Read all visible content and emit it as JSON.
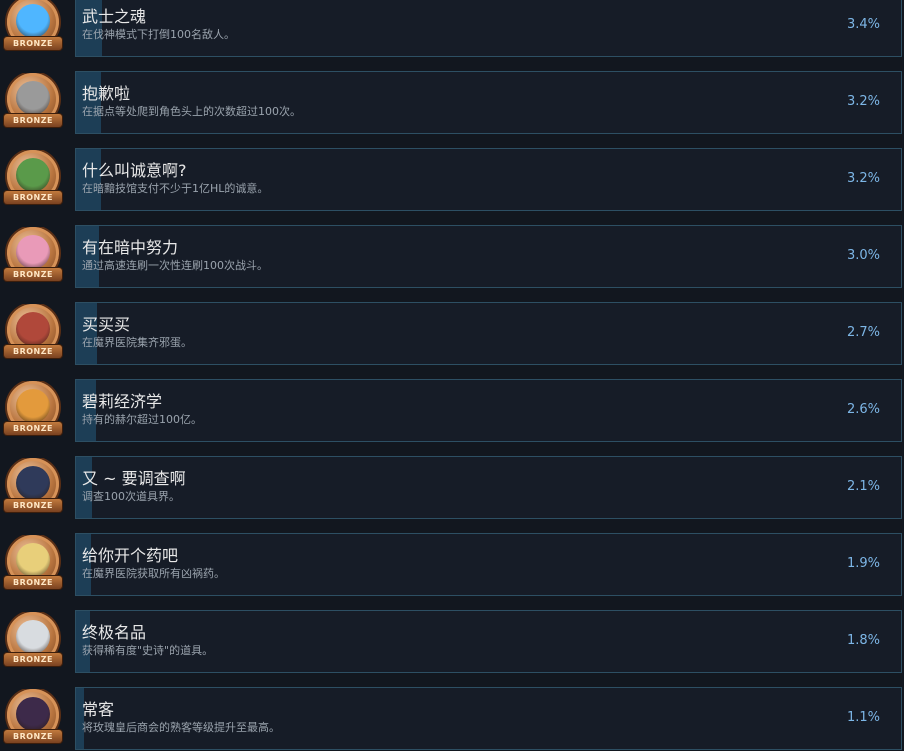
{
  "achievements": [
    {
      "title": "武士之魂",
      "description": "在伐神模式下打倒100名敌人。",
      "percent": "3.4%",
      "progress": 0.034,
      "badge": "BRONZE",
      "icon": "blue-flame-spirit-icon",
      "art_color": "#4fb6ff"
    },
    {
      "title": "抱歉啦",
      "description": "在据点等处爬到角色头上的次数超过100次。",
      "percent": "3.2%",
      "progress": 0.032,
      "badge": "BRONZE",
      "icon": "grey-prinny-face-icon",
      "art_color": "#9a9a9a"
    },
    {
      "title": "什么叫诚意啊?",
      "description": "在暗黯技馆支付不少于1亿HL的诚意。",
      "percent": "3.2%",
      "progress": 0.032,
      "badge": "BRONZE",
      "icon": "green-dragon-icon",
      "art_color": "#5a9a4a"
    },
    {
      "title": "有在暗中努力",
      "description": "通过高速连刷一次性连刷100次战斗。",
      "percent": "3.0%",
      "progress": 0.03,
      "badge": "BRONZE",
      "icon": "pink-hair-girl-icon",
      "art_color": "#e99ab8"
    },
    {
      "title": "买买买",
      "description": "在魔界医院集齐邪蛋。",
      "percent": "2.7%",
      "progress": 0.027,
      "badge": "BRONZE",
      "icon": "red-hair-duo-icon",
      "art_color": "#b0483a"
    },
    {
      "title": "碧莉经济学",
      "description": "持有的赫尔超过100亿。",
      "percent": "2.6%",
      "progress": 0.026,
      "badge": "BRONZE",
      "icon": "orange-hair-girl-icon",
      "art_color": "#e39a3c"
    },
    {
      "title": "又 ~ 要调查啊",
      "description": "调查100次道具界。",
      "percent": "2.1%",
      "progress": 0.021,
      "badge": "BRONZE",
      "icon": "hooded-ninja-icon",
      "art_color": "#2f3a5a"
    },
    {
      "title": "给你开个药吧",
      "description": "在魔界医院获取所有凶祸药。",
      "percent": "1.9%",
      "progress": 0.019,
      "badge": "BRONZE",
      "icon": "blonde-twins-icon",
      "art_color": "#e8cf7a"
    },
    {
      "title": "终极名品",
      "description": "获得稀有度\"史诗\"的道具。",
      "percent": "1.8%",
      "progress": 0.018,
      "badge": "BRONZE",
      "icon": "green-hair-pale-face-icon",
      "art_color": "#d8dce0"
    },
    {
      "title": "常客",
      "description": "将玫瑰皇后商会的熟客等级提升至最高。",
      "percent": "1.1%",
      "progress": 0.011,
      "badge": "BRONZE",
      "icon": "dark-hair-girl-icon",
      "art_color": "#3d2a4a"
    }
  ]
}
